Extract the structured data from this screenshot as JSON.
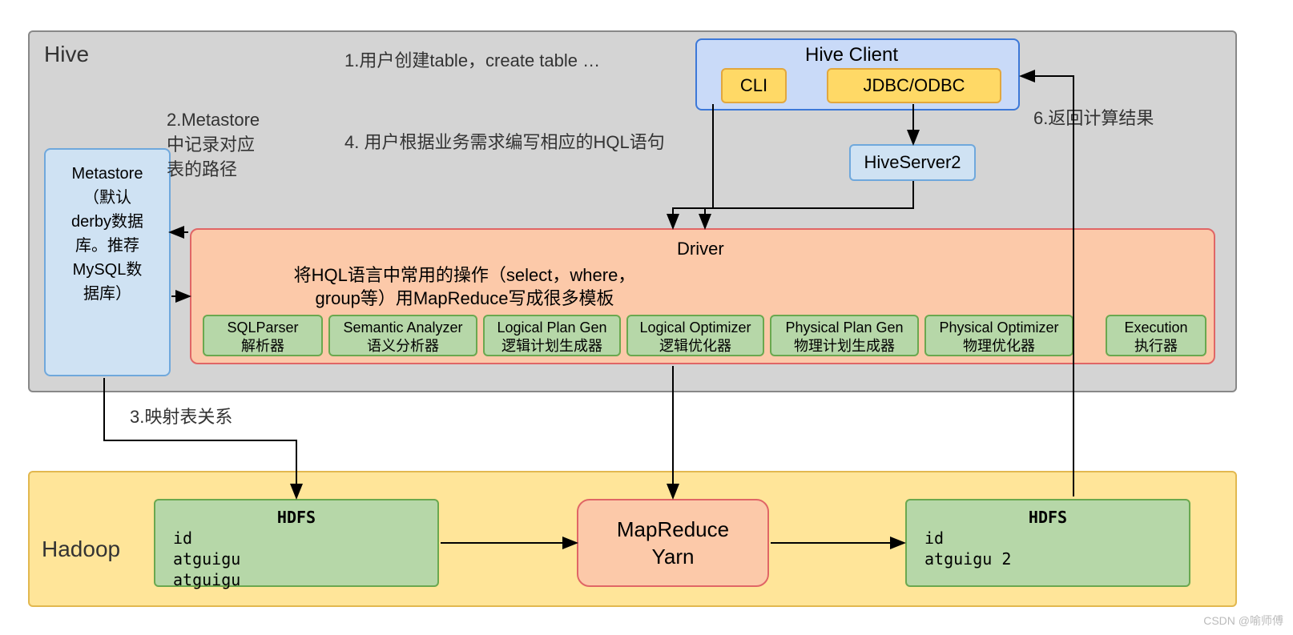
{
  "hive": {
    "label": "Hive"
  },
  "hadoop": {
    "label": "Hadoop"
  },
  "metastore": {
    "line1": "Metastore",
    "line2": "（默认",
    "line3": "derby数据",
    "line4": "库。推荐",
    "line5": "MySQL数",
    "line6": "据库）"
  },
  "hiveClient": {
    "label": "Hive Client",
    "cli": "CLI",
    "jdbc": "JDBC/ODBC"
  },
  "hiveserver2": "HiveServer2",
  "driver": {
    "label": "Driver",
    "desc1": "将HQL语言中常用的操作（select，where，",
    "desc2": "group等）用MapReduce写成很多模板",
    "components": [
      {
        "en": "SQLParser",
        "cn": "解析器"
      },
      {
        "en": "Semantic Analyzer",
        "cn": "语义分析器"
      },
      {
        "en": "Logical Plan Gen",
        "cn": "逻辑计划生成器"
      },
      {
        "en": "Logical Optimizer",
        "cn": "逻辑优化器"
      },
      {
        "en": "Physical Plan Gen",
        "cn": "物理计划生成器"
      },
      {
        "en": "Physical Optimizer",
        "cn": "物理优化器"
      },
      {
        "en": "Execution",
        "cn": "执行器"
      }
    ]
  },
  "hdfs1": {
    "title": "HDFS",
    "row1": "id",
    "row2": "atguigu",
    "row3": "atguigu"
  },
  "hdfs2": {
    "title": "HDFS",
    "row1": "id",
    "row2": "atguigu 2"
  },
  "mapreduce": {
    "line1": "MapReduce",
    "line2": "Yarn"
  },
  "steps": {
    "s1": "1.用户创建table，create table …",
    "s2_l1": "2.Metastore",
    "s2_l2": "中记录对应",
    "s2_l3": "表的路径",
    "s3": "3.映射表关系",
    "s4": "4. 用户根据业务需求编写相应的HQL语句",
    "s6": "6.返回计算结果"
  },
  "watermark": "CSDN @喻师傅"
}
